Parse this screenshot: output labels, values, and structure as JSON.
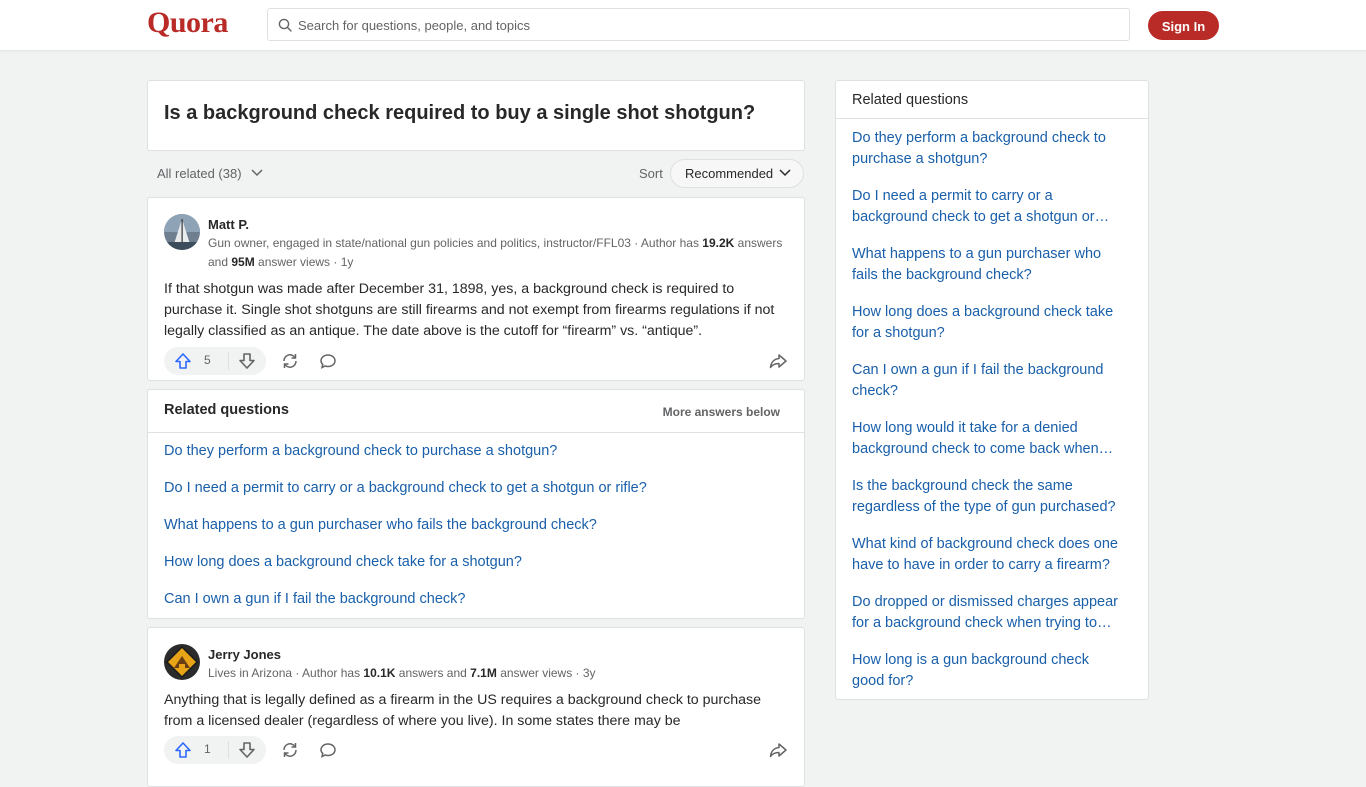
{
  "header": {
    "logo": "Quora",
    "search_placeholder": "Search for questions, people, and topics",
    "signin_label": "Sign In"
  },
  "question": {
    "title": "Is a background check required to buy a single shot shotgun?"
  },
  "filters": {
    "all_related": "All related (38)",
    "sort_label": "Sort",
    "sort_value": "Recommended"
  },
  "answers": [
    {
      "author": "Matt P.",
      "cred_prefix": "Gun owner, engaged in state/national gun policies and politics, instructor/FFL03 · Author has ",
      "answers_count": "19.2K",
      "cred_mid": " answers and ",
      "views_count": "95M",
      "cred_suffix": " answer views · 1y",
      "text": "If that shotgun was made after December 31, 1898, yes, a background check is required to purchase it. Single shot shotguns are still firearms and not exempt from firearms regulations if not legally classified as an antique. The date above is the cutoff for “firearm” vs. “antique”.",
      "upvotes": "5"
    },
    {
      "author": "Jerry Jones",
      "cred_prefix": "Lives in Arizona · Author has ",
      "answers_count": "10.1K",
      "cred_mid": " answers and ",
      "views_count": "7.1M",
      "cred_suffix": " answer views · 3y",
      "text": "Anything that is legally defined as a firearm in the US requires a background check to purchase from a licensed dealer (regardless of where you live). In some states there may be",
      "upvotes": "1"
    }
  ],
  "related_inline": {
    "title": "Related questions",
    "more": "More answers below",
    "items": [
      "Do they perform a background check to purchase a shotgun?",
      "Do I need a permit to carry or a background check to get a shotgun or rifle?",
      "What happens to a gun purchaser who fails the background check?",
      "How long does a background check take for a shotgun?",
      "Can I own a gun if I fail the background check?"
    ]
  },
  "sidebar": {
    "title": "Related questions",
    "items": [
      {
        "line1": "Do they perform a background check to",
        "line2": "purchase a shotgun?"
      },
      {
        "line1": "Do I need a permit to carry or a",
        "line2": "background check to get a shotgun or…"
      },
      {
        "line1": "What happens to a gun purchaser who",
        "line2": "fails the background check?"
      },
      {
        "line1": "How long does a background check take",
        "line2": "for a shotgun?"
      },
      {
        "line1": "Can I own a gun if I fail the background",
        "line2": "check?"
      },
      {
        "line1": "How long would it take for a denied",
        "line2": "background check to come back when…"
      },
      {
        "line1": "Is the background check the same",
        "line2": "regardless of the type of gun purchased?"
      },
      {
        "line1": "What kind of background check does one",
        "line2": "have to have in order to carry a firearm?"
      },
      {
        "line1": "Do dropped or dismissed charges appear",
        "line2": "for a background check when trying to…"
      },
      {
        "line1": "How long is a gun background check",
        "line2": "good for?"
      }
    ]
  },
  "colors": {
    "brand": "#b92b27",
    "link": "#195faa",
    "upvote": "#2e69ff"
  }
}
